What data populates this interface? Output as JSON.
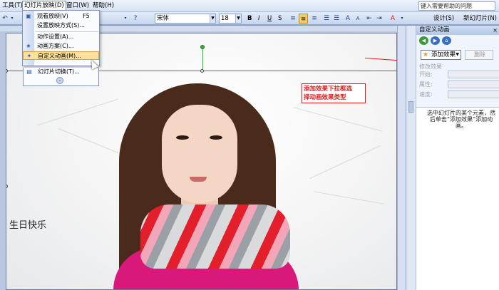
{
  "menubar": {
    "items": [
      "工具(T)",
      "幻灯片放映(D)",
      "窗口(W)",
      "帮助(H)"
    ],
    "active_index": 1,
    "help_search_placeholder": "键入需要帮助的问题"
  },
  "toolbar": {
    "font_name": "宋体",
    "font_size": "18",
    "bold": "B",
    "italic": "I",
    "underline": "U",
    "shadow": "S",
    "design_label": "设计(S)",
    "new_slide_label": "新幻灯片(N)"
  },
  "dropdown": {
    "items": [
      {
        "label": "观看放映(V)",
        "shortcut": "F5"
      },
      {
        "label": "设置放映方式(S)..."
      },
      {
        "label": "动作设置(A)..."
      },
      {
        "label": "动画方案(C)..."
      },
      {
        "label": "自定义动画(M)..."
      },
      {
        "label": "幻灯片切换(T)..."
      }
    ],
    "highlighted_index": 4
  },
  "slide": {
    "text": "生日快乐"
  },
  "annotation": {
    "line1": "添加效果下拉框选",
    "line2": "择动画效果类型"
  },
  "task_pane": {
    "title": "自定义动画",
    "close": "×",
    "add_effect_label": "添加效果",
    "remove_label": "删除",
    "modify_section": "修改效果",
    "start_label": "开始:",
    "property_label": "属性:",
    "speed_label": "速度:",
    "hint": "选中幻灯片的某个元素，然后单击“添加效果”添加动画。"
  },
  "colors": {
    "accent_red": "#e31b1b",
    "menu_highlight": "#fbe0a0",
    "toolbar_blue": "#c6d6ee"
  }
}
